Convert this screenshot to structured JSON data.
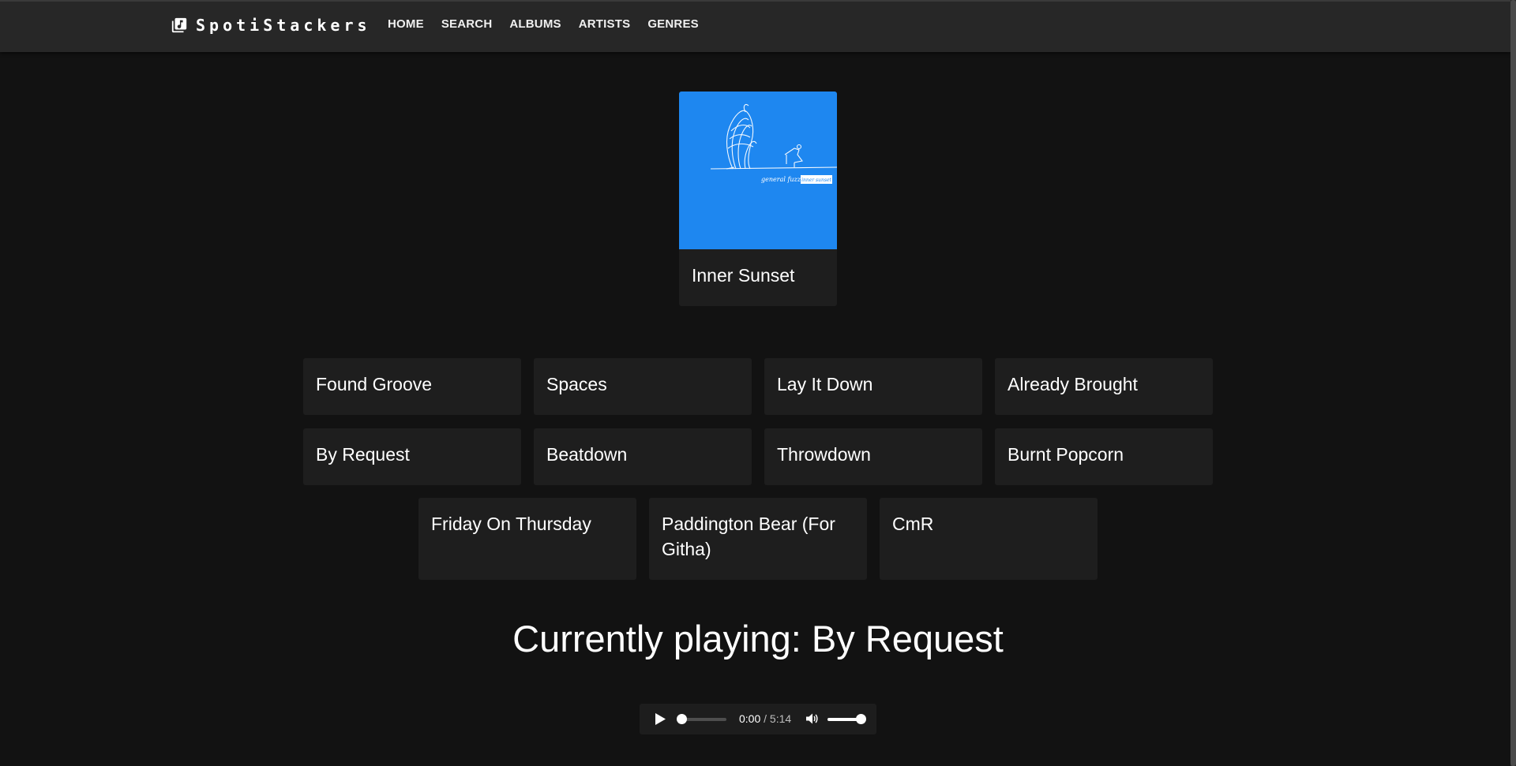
{
  "brand": {
    "name": "SpotiStackers",
    "icon": "music-library-icon"
  },
  "nav": [
    {
      "label": "HOME"
    },
    {
      "label": "SEARCH"
    },
    {
      "label": "ALBUMS"
    },
    {
      "label": "ARTISTS"
    },
    {
      "label": "GENRES"
    }
  ],
  "album": {
    "title": "Inner Sunset",
    "cover": {
      "color": "#1e87f0",
      "artist_text": "general fuzz",
      "title_text": "inner sunset"
    }
  },
  "tracks": [
    {
      "label": "Found Groove"
    },
    {
      "label": "Spaces"
    },
    {
      "label": "Lay It Down"
    },
    {
      "label": "Already Brought"
    },
    {
      "label": "By Request"
    },
    {
      "label": "Beatdown"
    },
    {
      "label": "Throwdown"
    },
    {
      "label": "Burnt Popcorn"
    },
    {
      "label": "Friday On Thursday"
    },
    {
      "label": "Paddington Bear (For Githa)"
    },
    {
      "label": "CmR"
    }
  ],
  "now_playing": {
    "text": "Currently playing: By Request"
  },
  "player": {
    "current_time": "0:00",
    "separator": "/",
    "duration": "5:14",
    "progress": 0,
    "volume": 1
  },
  "colors": {
    "background": "#121212",
    "topbar": "#272727",
    "card": "#1e1e1e",
    "accent": "#1e87f0"
  }
}
